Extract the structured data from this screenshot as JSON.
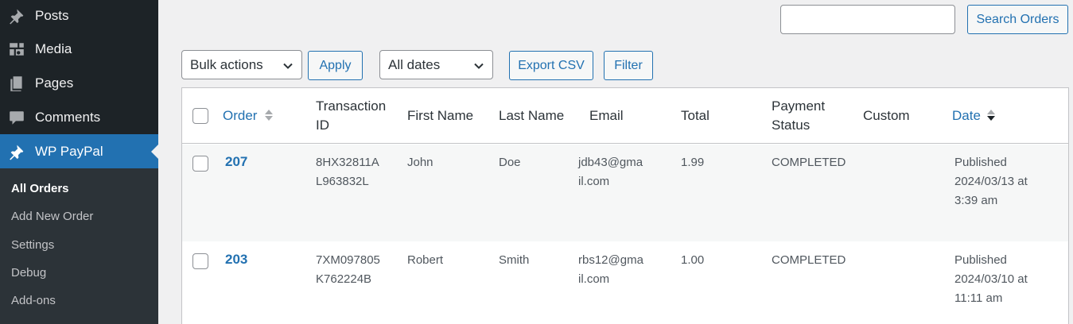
{
  "sidebar": {
    "items": [
      {
        "label": "Posts",
        "icon": "pin-icon"
      },
      {
        "label": "Media",
        "icon": "media-icon"
      },
      {
        "label": "Pages",
        "icon": "pages-icon"
      },
      {
        "label": "Comments",
        "icon": "comment-icon"
      },
      {
        "label": "WP PayPal",
        "icon": "pin-icon"
      }
    ],
    "submenu": [
      {
        "label": "All Orders"
      },
      {
        "label": "Add New Order"
      },
      {
        "label": "Settings"
      },
      {
        "label": "Debug"
      },
      {
        "label": "Add-ons"
      }
    ]
  },
  "search": {
    "value": "",
    "button": "Search Orders"
  },
  "toolbar": {
    "bulk_actions": "Bulk actions",
    "apply": "Apply",
    "dates": "All dates",
    "export": "Export CSV",
    "filter": "Filter"
  },
  "table": {
    "headers": {
      "order": "Order",
      "transaction_1": "Transaction",
      "transaction_2": "ID",
      "first_name": "First Name",
      "last_name": "Last Name",
      "email": "Email",
      "total": "Total",
      "payment_1": "Payment",
      "payment_2": "Status",
      "custom": "Custom",
      "date": "Date"
    },
    "rows": [
      {
        "order": "207",
        "txn_1": "8HX32811A",
        "txn_2": "L963832L",
        "first_name": "John",
        "last_name": "Doe",
        "email_1": "jdb43@gma",
        "email_2": "il.com",
        "total": "1.99",
        "status": "COMPLETED",
        "custom": "",
        "date_1": "Published",
        "date_2": "2024/03/13 at",
        "date_3": "3:39 am"
      },
      {
        "order": "203",
        "txn_1": "7XM097805",
        "txn_2": "K762224B",
        "first_name": "Robert",
        "last_name": "Smith",
        "email_1": "rbs12@gma",
        "email_2": "il.com",
        "total": "1.00",
        "status": "COMPLETED",
        "custom": "",
        "date_1": "Published",
        "date_2": "2024/03/10 at",
        "date_3": "11:11 am"
      }
    ]
  },
  "colors": {
    "sidebar_bg": "#1d2327",
    "submenu_bg": "#2c3338",
    "accent": "#2271b1",
    "page_bg": "#f0f0f1"
  }
}
